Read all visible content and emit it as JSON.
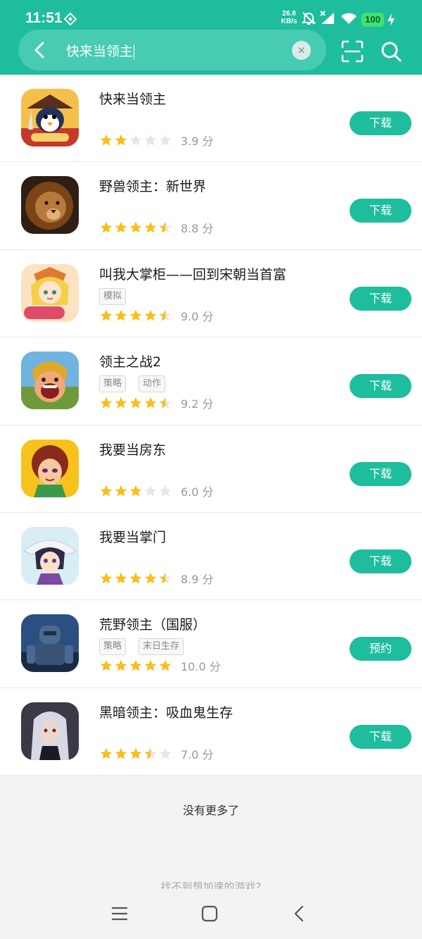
{
  "status_bar": {
    "time": "11:51",
    "net_speed_value": "26.8",
    "net_speed_unit": "KB/s",
    "battery": "100"
  },
  "search": {
    "query": "快来当领主",
    "clear_label": "×"
  },
  "games": [
    {
      "name": "快来当领主",
      "tags": [],
      "rating": 2,
      "score": "3.9 分",
      "button": "下载"
    },
    {
      "name": "野兽领主：新世界",
      "tags": [],
      "rating": 4.5,
      "score": "8.8 分",
      "button": "下载"
    },
    {
      "name": "叫我大掌柜——回到宋朝当首富",
      "tags": [
        "模拟"
      ],
      "rating": 4.5,
      "score": "9.0 分",
      "button": "下载"
    },
    {
      "name": "领主之战2",
      "tags": [
        "策略",
        "动作"
      ],
      "rating": 4.5,
      "score": "9.2 分",
      "button": "下载"
    },
    {
      "name": "我要当房东",
      "tags": [],
      "rating": 3,
      "score": "6.0 分",
      "button": "下载"
    },
    {
      "name": "我要当掌门",
      "tags": [],
      "rating": 4.5,
      "score": "8.9 分",
      "button": "下载"
    },
    {
      "name": "荒野领主（国服）",
      "tags": [
        "策略",
        "末日生存"
      ],
      "rating": 5,
      "score": "10.0 分",
      "button": "预约"
    },
    {
      "name": "黑暗领主：吸血鬼生存",
      "tags": [],
      "rating": 3.5,
      "score": "7.0 分",
      "button": "下载"
    }
  ],
  "icons": [
    "penguin-game-icon",
    "lion-game-icon",
    "anime-girl-game-icon",
    "warrior-game-icon",
    "woman-game-icon",
    "swordsman-game-icon",
    "robot-game-icon",
    "vampire-game-icon"
  ],
  "colors": {
    "accent": "#1dbd9d",
    "star_on": "#fbbd18",
    "star_off": "#e6e6e6"
  },
  "footer": {
    "no_more": "没有更多了",
    "feedback": "找不到想加速的游戏?"
  }
}
